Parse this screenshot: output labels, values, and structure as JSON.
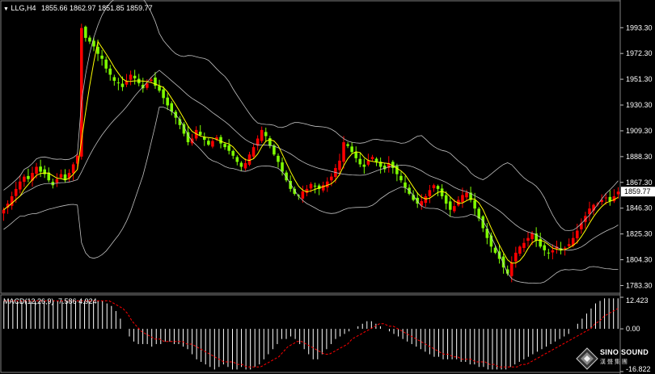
{
  "header": {
    "symbol": "LLG,H4",
    "ohlc": "1855.66 1862.97 1851.85 1859.77"
  },
  "macd_header": {
    "label": "MACD(12,26,9)",
    "values": "7.586 4.924"
  },
  "logo": {
    "name": "SINO SOUND",
    "sub": "漢 聲 集 團"
  },
  "colors": {
    "up": "#ff0000",
    "down": "#7fff00",
    "ma": "#ffff00",
    "bands": "#c0c0c0",
    "signal": "#ff0000",
    "hist": "#ffffff"
  },
  "chart_data": [
    {
      "type": "candlestick",
      "title": "LLG,H4",
      "price_axis_ticks": [
        "1993.30",
        "1972.30",
        "1951.30",
        "1930.30",
        "1909.30",
        "1888.30",
        "1867.30",
        "1846.30",
        "1825.30",
        "1804.30",
        "1783.30"
      ],
      "current_price_label": "1859.77",
      "ylim": [
        1779,
        2004
      ],
      "ma_line": true,
      "bollinger_bands": true,
      "close_series": [
        1845,
        1850,
        1856,
        1862,
        1868,
        1872,
        1870,
        1875,
        1880,
        1876,
        1874,
        1869,
        1865,
        1870,
        1874,
        1869,
        1875,
        1882,
        1889,
        1993,
        1985,
        1982,
        1978,
        1972,
        1968,
        1960,
        1955,
        1950,
        1948,
        1945,
        1950,
        1955,
        1952,
        1948,
        1944,
        1948,
        1951,
        1946,
        1942,
        1936,
        1930,
        1925,
        1920,
        1914,
        1907,
        1900,
        1903,
        1910,
        1906,
        1902,
        1898,
        1901,
        1904,
        1899,
        1896,
        1893,
        1889,
        1884,
        1880,
        1883,
        1890,
        1896,
        1903,
        1910,
        1905,
        1897,
        1890,
        1884,
        1876,
        1869,
        1862,
        1858,
        1856,
        1860,
        1862,
        1866,
        1864,
        1862,
        1865,
        1868,
        1872,
        1879,
        1885,
        1900,
        1897,
        1892,
        1887,
        1882,
        1880,
        1885,
        1888,
        1884,
        1880,
        1878,
        1883,
        1879,
        1874,
        1869,
        1863,
        1858,
        1853,
        1850,
        1852,
        1856,
        1861,
        1865,
        1862,
        1856,
        1850,
        1845,
        1848,
        1853,
        1857,
        1859,
        1853,
        1846,
        1838,
        1830,
        1822,
        1815,
        1810,
        1805,
        1798,
        1793,
        1802,
        1810,
        1815,
        1818,
        1822,
        1826,
        1820,
        1815,
        1812,
        1810,
        1812,
        1815,
        1812,
        1814,
        1817,
        1822,
        1828,
        1834,
        1840,
        1846,
        1849,
        1850,
        1853,
        1855,
        1852,
        1856,
        1859.77
      ]
    },
    {
      "type": "bar",
      "title": "MACD(12,26,9)",
      "axis_ticks": [
        "12.423",
        "0.00",
        "-16.822"
      ],
      "ylim": [
        -16.822,
        12.423
      ],
      "macd": 7.586,
      "signal_value": 4.924,
      "histogram": [
        11,
        11,
        11,
        11,
        11,
        11,
        11,
        11,
        11,
        11,
        11,
        11,
        11,
        11,
        11,
        11,
        11,
        11,
        11,
        11,
        11,
        11,
        11,
        10,
        9,
        7,
        4,
        0,
        -3,
        -5,
        -6,
        -6,
        -6,
        -7,
        -6,
        -6,
        -5,
        -5,
        -6,
        -6,
        -7,
        -8,
        -10,
        -12,
        -13,
        -14,
        -15,
        -16,
        -15,
        -14,
        -15,
        -16,
        -16,
        -15,
        -16,
        -16,
        -15,
        -14,
        -12,
        -10,
        -8,
        -6,
        -4,
        -4,
        -3,
        -4,
        -6,
        -8,
        -10,
        -12,
        -12,
        -10,
        -8,
        -6,
        -4,
        -3,
        -2,
        -1,
        0,
        1,
        2,
        3,
        3,
        2,
        1,
        0,
        -1,
        -2,
        -3,
        -4,
        -5,
        -6,
        -7,
        -8,
        -9,
        -10,
        -11,
        -11,
        -12,
        -12,
        -12,
        -12,
        -13,
        -13,
        -14,
        -14,
        -15,
        -15,
        -16,
        -16,
        -16,
        -16,
        -16,
        -15,
        -14,
        -13,
        -12,
        -11,
        -10,
        -9,
        -8,
        -7,
        -6,
        -5,
        -4,
        -3,
        -2,
        0,
        2,
        4,
        6,
        8,
        10,
        11,
        12,
        12,
        12,
        12
      ],
      "signal": [
        11,
        11,
        11,
        11,
        11,
        11,
        11,
        11,
        11,
        11,
        11,
        11,
        11,
        11,
        11,
        11,
        11,
        11,
        11,
        11,
        11,
        11,
        11,
        11,
        10,
        9,
        8,
        6,
        3,
        1,
        -1,
        -2,
        -3,
        -4,
        -4,
        -5,
        -5,
        -5,
        -5,
        -5,
        -6,
        -6,
        -7,
        -8,
        -9,
        -10,
        -11,
        -12,
        -13,
        -13,
        -13,
        -14,
        -14,
        -15,
        -15,
        -15,
        -15,
        -14,
        -13,
        -12,
        -11,
        -9,
        -7,
        -6,
        -5,
        -5,
        -6,
        -7,
        -8,
        -9,
        -10,
        -10,
        -9,
        -8,
        -7,
        -6,
        -4,
        -3,
        -2,
        -1,
        0,
        1,
        2,
        2,
        1,
        1,
        0,
        -1,
        -2,
        -3,
        -4,
        -5,
        -6,
        -7,
        -8,
        -9,
        -10,
        -10,
        -11,
        -11,
        -12,
        -12,
        -12,
        -13,
        -13,
        -13,
        -14,
        -14,
        -15,
        -15,
        -15,
        -15,
        -15,
        -14,
        -14,
        -13,
        -12,
        -11,
        -10,
        -9,
        -8,
        -7,
        -6,
        -5,
        -4,
        -3,
        -2,
        -1,
        0,
        2,
        3,
        5,
        6,
        7,
        8
      ]
    }
  ]
}
